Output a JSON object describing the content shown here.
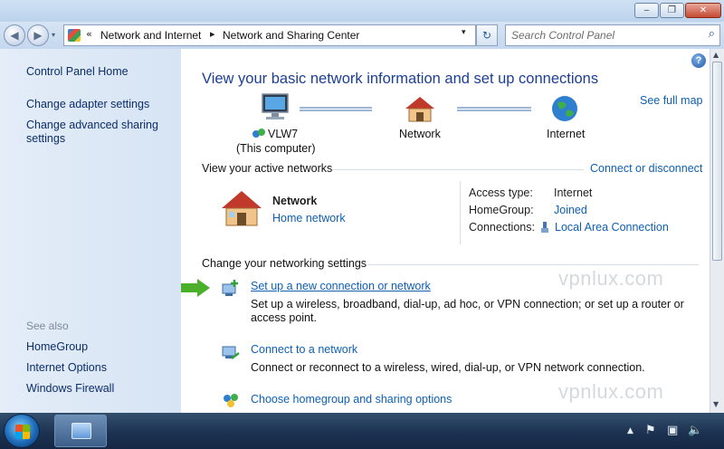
{
  "window": {
    "minimize_glyph": "‒",
    "maximize_glyph": "❐",
    "close_glyph": "✕"
  },
  "navbar": {
    "back_glyph": "◀",
    "forward_glyph": "▶",
    "history_glyph": "▾",
    "breadcrumb_prefix": "«",
    "breadcrumb": [
      "Network and Internet",
      "Network and Sharing Center"
    ],
    "breadcrumb_separator": "▸",
    "address_dropdown_glyph": "▾",
    "refresh_glyph": "↻",
    "search_placeholder": "Search Control Panel",
    "search_icon": "magnifier-icon",
    "search_glyph": "⌕"
  },
  "sidebar": {
    "links": [
      "Control Panel Home",
      "Change adapter settings",
      "Change advanced sharing",
      "settings"
    ],
    "see_also_label": "See also",
    "see_also": [
      "HomeGroup",
      "Internet Options",
      "Windows Firewall"
    ]
  },
  "main": {
    "help_glyph": "?",
    "heading": "View your basic network information and set up connections",
    "see_full_map": "See full map",
    "map": {
      "computer_name": "VLW7",
      "computer_sub": "(This computer)",
      "network_label": "Network",
      "internet_label": "Internet"
    },
    "active_networks": {
      "header": "View your active networks",
      "connect_link": "Connect or disconnect",
      "network_name": "Network",
      "network_type": "Home network",
      "access_type_label": "Access type:",
      "access_type_value": "Internet",
      "homegroup_label": "HomeGroup:",
      "homegroup_value": "Joined",
      "connections_label": "Connections:",
      "connections_value": "Local Area Connection"
    },
    "settings": {
      "header": "Change your networking settings",
      "tasks": [
        {
          "title": "Set up a new connection or network",
          "desc": "Set up a wireless, broadband, dial-up, ad hoc, or VPN connection; or set up a router or access point."
        },
        {
          "title": "Connect to a network",
          "desc": "Connect or reconnect to a wireless, wired, dial-up, or VPN network connection."
        },
        {
          "title": "Choose homegroup and sharing options",
          "desc": ""
        }
      ]
    },
    "watermark": "vpnlux.com"
  },
  "taskbar": {
    "tray_icons": [
      "show-hidden-icons",
      "action-center-icon",
      "network-icon",
      "volume-icon"
    ],
    "tray_glyphs": [
      "▲",
      "⚑",
      "▣",
      "🔈"
    ]
  },
  "colors": {
    "link": "#0e5fb4",
    "heading": "#1c3f94",
    "left_pane_link": "#0c2d6a",
    "highlight_arrow": "#4caf2a"
  }
}
